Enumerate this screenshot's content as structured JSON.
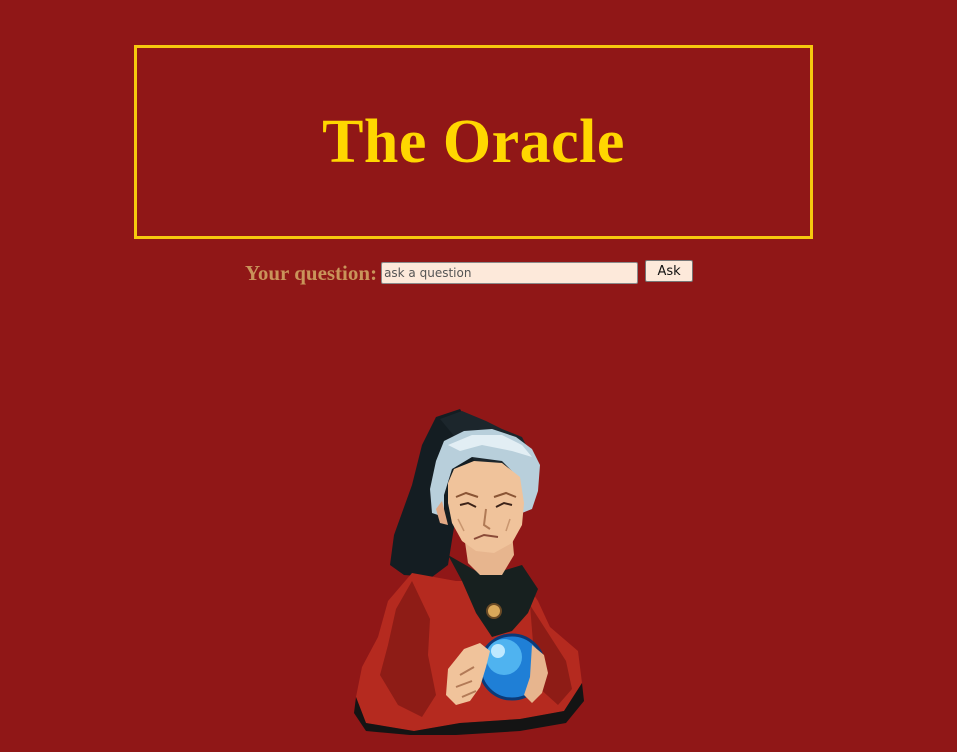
{
  "header": {
    "title": "The Oracle"
  },
  "question": {
    "label": "Your question:",
    "placeholder": "ask a question",
    "value": "",
    "ask_label": "Ask"
  },
  "colors": {
    "background": "#901717",
    "title": "#ffd700",
    "title_border": "#f6c90e",
    "label": "#c9945a",
    "input_background": "#fde9da"
  },
  "illustration": {
    "subject": "oracle-fortune-teller-with-crystal-ball"
  }
}
